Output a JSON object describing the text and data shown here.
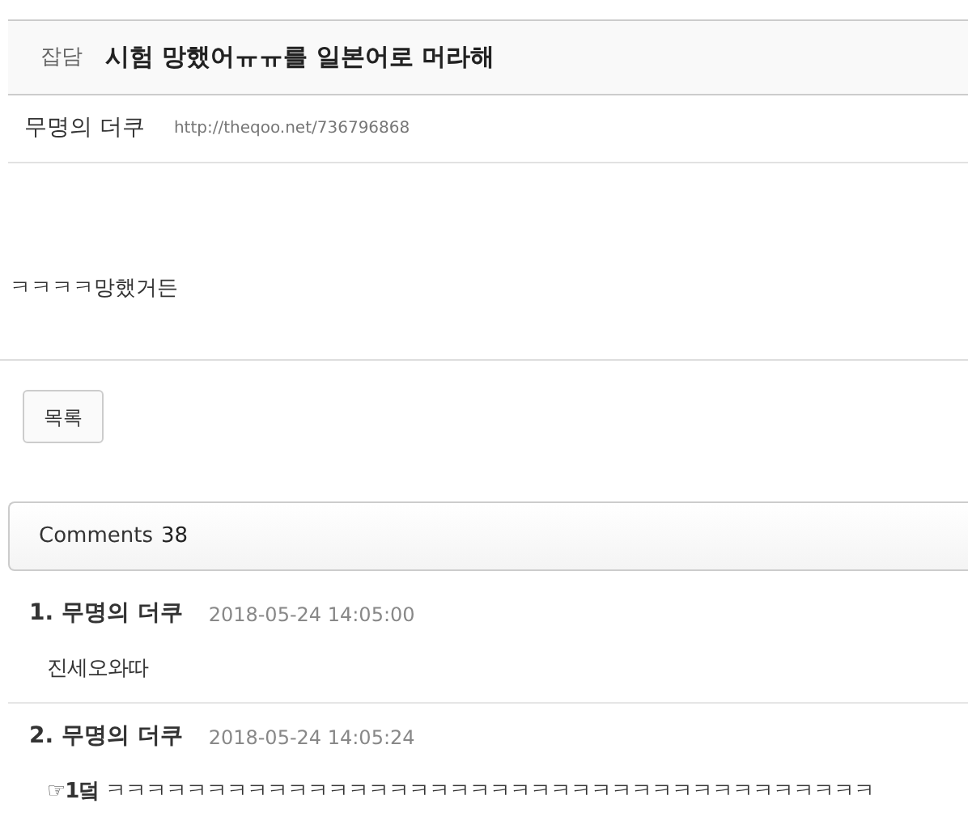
{
  "post": {
    "category": "잡담",
    "title": "시험 망했어ㅠㅠ를 일본어로 머라해",
    "author": "무명의 더쿠",
    "url": "http://theqoo.net/736796868",
    "body": "ㅋㅋㅋㅋ망했거든"
  },
  "list_button": "목록",
  "comments_header": {
    "label": "Comments",
    "count": "38"
  },
  "comments": [
    {
      "number": "1.",
      "author": "무명의 더쿠",
      "time": "2018-05-24 14:05:00",
      "text": "진세오와따"
    },
    {
      "number": "2.",
      "author": "무명의 더쿠",
      "time": "2018-05-24 14:05:24",
      "text": "**☞1덬** ㅋㅋㅋㅋㅋㅋㅋㅋㅋㅋㅋㅋㅋㅋㅋㅋㅋㅋㅋㅋㅋㅋㅋㅋㅋㅋㅋㅋㅋㅋㅋㅋㅋㅋㅋㅋㅋㅋ"
    }
  ]
}
